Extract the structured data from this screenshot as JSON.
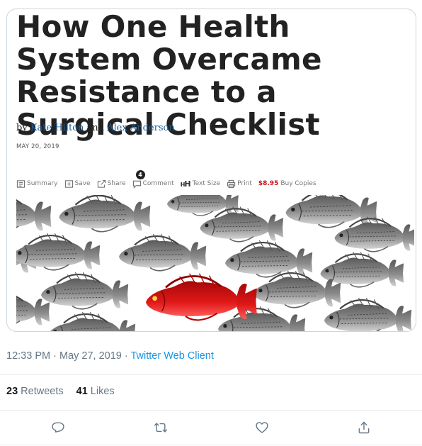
{
  "article": {
    "headline": "How One Health System Overcame Resistance to a Surgical Checklist",
    "byline_prefix": "by",
    "author1": "Kate Hilton",
    "byline_and": "and",
    "author2": "Alex Anderson",
    "date": "MAY 20, 2019",
    "toolbar": {
      "summary": "Summary",
      "save": "Save",
      "share": "Share",
      "comment_count": "4",
      "comment": "Comment",
      "text_size": "Text Size",
      "print": "Print",
      "price": "$8.95",
      "buy": "Buy Copies"
    }
  },
  "tweet": {
    "time": "12:33 PM",
    "date": "May 27, 2019",
    "client": "Twitter Web Client",
    "retweets_count": "23",
    "retweets_label": "Retweets",
    "likes_count": "41",
    "likes_label": "Likes"
  },
  "colors": {
    "link": "#1b95e0",
    "muted": "#657786",
    "author_link": "#1a5e9a",
    "price": "#c4161c",
    "highlight_fish": "#d41414"
  },
  "icons": [
    "summary-icon",
    "save-icon",
    "share-icon",
    "comment-icon",
    "print-icon",
    "reply-icon",
    "retweet-icon",
    "like-icon",
    "share-tweet-icon"
  ]
}
